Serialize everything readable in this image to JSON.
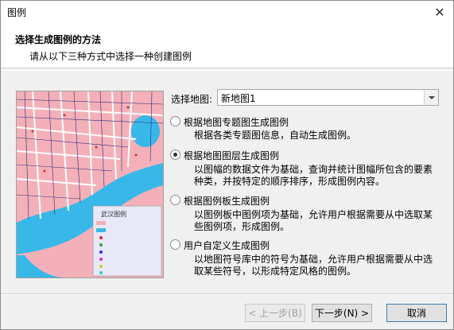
{
  "window": {
    "title": "图例",
    "close_icon": "close-icon"
  },
  "header": {
    "title": "选择生成图例的方法",
    "subtitle": "请从以下三种方式中选择一种创建图例"
  },
  "map_select": {
    "label": "选择地图:",
    "value": "新地图1"
  },
  "preview": {
    "legend_title": "武汉图例"
  },
  "options": [
    {
      "label": "根据地图专题图生成图例",
      "desc": "根据各类专题图信息，自动生成图例。",
      "checked": false
    },
    {
      "label": "根据地图图层生成图例",
      "desc": "以图幅的数据文件为基础，查询并统计图幅所包含的要素种类，并按特定的顺序排序，形成图例内容。",
      "checked": true
    },
    {
      "label": "根据图例板生成图例",
      "desc": "以图例板中图例项为基础，允许用户根据需要从中选取某些图例项，形成图例。",
      "checked": false
    },
    {
      "label": "用户自定义生成图例",
      "desc": "以地图符号库中的符号为基础，允许用户根据需要从中选取某些符号，以形成特定风格的图例。",
      "checked": false
    }
  ],
  "buttons": {
    "prev": "< 上一步(B)",
    "next": "下一步(N) >",
    "cancel": "取消"
  },
  "colors": {
    "map_block": "#f4b0b8",
    "water": "#38b8e8",
    "road": "#ffffff",
    "border": "#2a2a80"
  }
}
